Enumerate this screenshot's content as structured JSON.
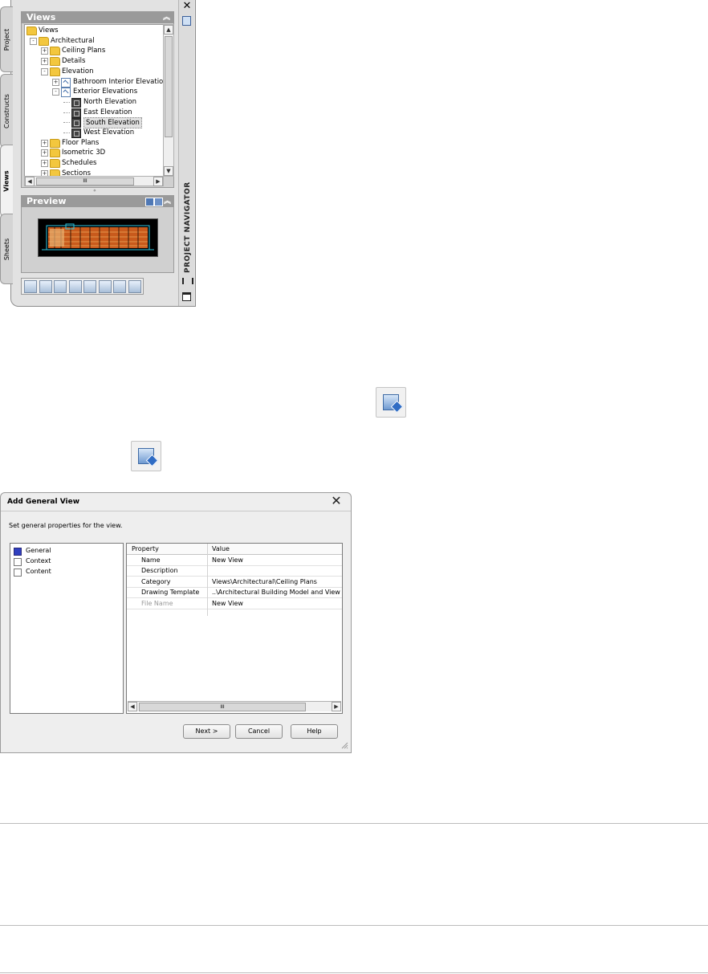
{
  "navigator": {
    "title": "PROJECT NAVIGATOR",
    "tabs": [
      "Project",
      "Constructs",
      "Views",
      "Sheets"
    ],
    "active_tab": "Views",
    "views_panel_title": "Views",
    "preview_panel_title": "Preview",
    "tree": [
      {
        "label": "Views",
        "depth": 0,
        "icon": "folder-icon",
        "toggle": ""
      },
      {
        "label": "Architectural",
        "depth": 1,
        "icon": "folder-icon",
        "toggle": "-"
      },
      {
        "label": "Ceiling Plans",
        "depth": 2,
        "icon": "folder-icon",
        "toggle": "+"
      },
      {
        "label": "Details",
        "depth": 2,
        "icon": "folder-icon",
        "toggle": "+"
      },
      {
        "label": "Elevation",
        "depth": 2,
        "icon": "folder-icon",
        "toggle": "-"
      },
      {
        "label": "Bathroom Interior Elevations",
        "depth": 3,
        "icon": "view-icon",
        "toggle": "+"
      },
      {
        "label": "Exterior Elevations",
        "depth": 3,
        "icon": "view-icon",
        "toggle": "-"
      },
      {
        "label": "North Elevation",
        "depth": 4,
        "icon": "elevation-icon",
        "toggle": ""
      },
      {
        "label": "East Elevation",
        "depth": 4,
        "icon": "elevation-icon",
        "toggle": ""
      },
      {
        "label": "South Elevation",
        "depth": 4,
        "icon": "elevation-icon",
        "toggle": "",
        "selected": true
      },
      {
        "label": "West Elevation",
        "depth": 4,
        "icon": "elevation-icon",
        "toggle": ""
      },
      {
        "label": "Floor Plans",
        "depth": 2,
        "icon": "folder-icon",
        "toggle": "+"
      },
      {
        "label": "Isometric 3D",
        "depth": 2,
        "icon": "folder-icon",
        "toggle": "+"
      },
      {
        "label": "Schedules",
        "depth": 2,
        "icon": "folder-icon",
        "toggle": "+"
      },
      {
        "label": "Sections",
        "depth": 2,
        "icon": "folder-icon",
        "toggle": "+"
      }
    ],
    "scroll_arrows": {
      "up": "▲",
      "down": "▼",
      "left": "◀",
      "right": "▶",
      "grip": "III"
    },
    "toolbar_icons": [
      "add-category-icon",
      "add-view-icon",
      "add-detail-view-icon",
      "regenerate-icon",
      "select-icon",
      "schedule-icon",
      "repath-icon",
      "sheet-set-icon"
    ],
    "strip_close": "✕"
  },
  "dialog": {
    "title": "Add General View",
    "description": "Set general properties for the view.",
    "close_glyph": "✕",
    "sections": [
      {
        "label": "General",
        "checked": true
      },
      {
        "label": "Context",
        "checked": false
      },
      {
        "label": "Content",
        "checked": false
      }
    ],
    "columns": {
      "property": "Property",
      "value": "Value"
    },
    "rows": [
      {
        "property": "Name",
        "value": "New View",
        "disabled": false
      },
      {
        "property": "Description",
        "value": "",
        "disabled": false
      },
      {
        "property": "Category",
        "value": "Views\\Architectural\\Ceiling Plans",
        "disabled": false
      },
      {
        "property": "Drawing Template",
        "value": "..\\Architectural Building Model and View (",
        "disabled": false
      },
      {
        "property": "File Name",
        "value": "New View",
        "disabled": true
      }
    ],
    "buttons": {
      "next": "Next >",
      "cancel": "Cancel",
      "help": "Help"
    }
  }
}
